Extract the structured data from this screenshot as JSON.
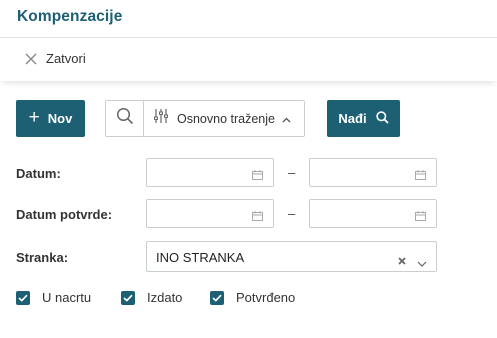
{
  "header": {
    "title": "Kompenzacije"
  },
  "toolbar": {
    "close_label": "Zatvori"
  },
  "actions": {
    "new_label": "Nov",
    "advanced_search_label": "Osnovno traženje",
    "find_label": "Nađi"
  },
  "filters": {
    "date_label": "Datum:",
    "confirm_date_label": "Datum potvrde:",
    "partner_label": "Stranka:",
    "partner_value": "INO STRANKA",
    "range_separator": "–",
    "date_from": "",
    "date_to": "",
    "confirm_date_from": "",
    "confirm_date_to": ""
  },
  "status_filters": [
    {
      "label": "U nacrtu",
      "checked": true
    },
    {
      "label": "Izdato",
      "checked": true
    },
    {
      "label": "Potvrđeno",
      "checked": true
    }
  ],
  "colors": {
    "accent": "#1d5f73",
    "border": "#c9ced2",
    "text": "#333333"
  }
}
